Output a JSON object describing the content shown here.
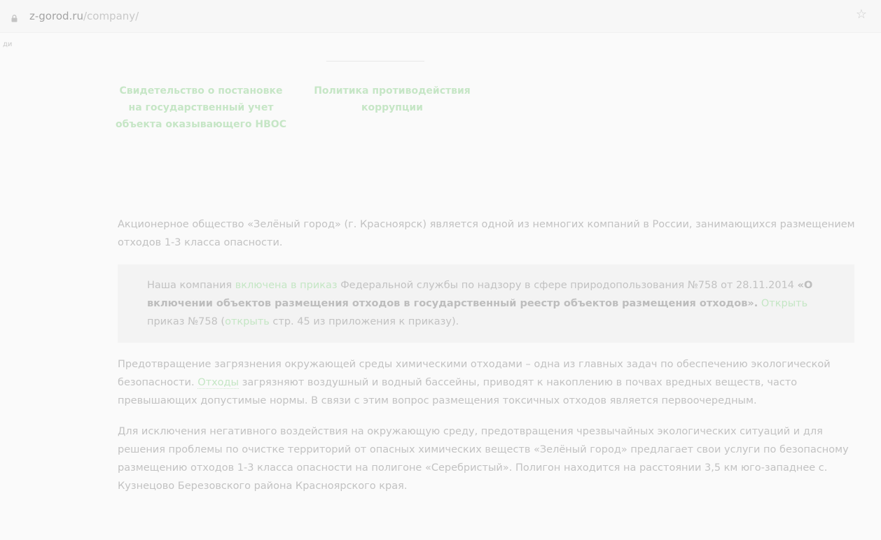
{
  "browser": {
    "url_host": "z-gorod.ru",
    "url_path": "/company/",
    "bookmark_text": "ди"
  },
  "documents": [
    {
      "line1": "Свидетельство о постановке",
      "line2": "на государственный учет",
      "line3": "объекта оказывающего НВОС"
    },
    {
      "line1": "Политика противодействия",
      "line2": "коррупции"
    }
  ],
  "intro": "Акционерное общество «Зелёный город» (г. Красноярск) является одной из немногих компаний в России, занимающихся размещением отходов 1-3 класса опасности.",
  "quote": {
    "part1": "Наша компания ",
    "link1": "включена в приказ",
    "part2": " Федеральной службы по надзору в сфере природопользования №758 от 28.11.2014 ",
    "bold": "«О включении объектов размещения отходов в государственный реестр объектов размещения отходов».",
    "part3": " ",
    "link2": "Открыть",
    "part4": " приказ №758 (",
    "link3": "открыть",
    "part5": " стр. 45 из приложения к приказу)."
  },
  "paragraph2": {
    "part1": "Предотвращение загрязнения окружающей среды химическими отходами – одна из главных задач по обеспечению экологической безопасности. ",
    "link": "Отходы",
    "part2": " загрязняют воздушный и водный бассейны, приводят к накоплению в почвах вредных веществ, часто превышающих допустимые нормы. В связи с этим вопрос размещения токсичных отходов является первоочередным."
  },
  "paragraph3": "Для исключения негативного воздействия на окружающую среду, предотвращения чрезвычайных экологических ситуаций и для решения проблемы по очистке территорий от опасных химических веществ «Зелёный город» предлагает свои услуги по безопасному размещению отходов 1-3 класса опасности на полигоне «Серебристый». Полигон находится на расстоянии 3,5 км юго-западнее с. Кузнецово Березовского района Красноярского края."
}
